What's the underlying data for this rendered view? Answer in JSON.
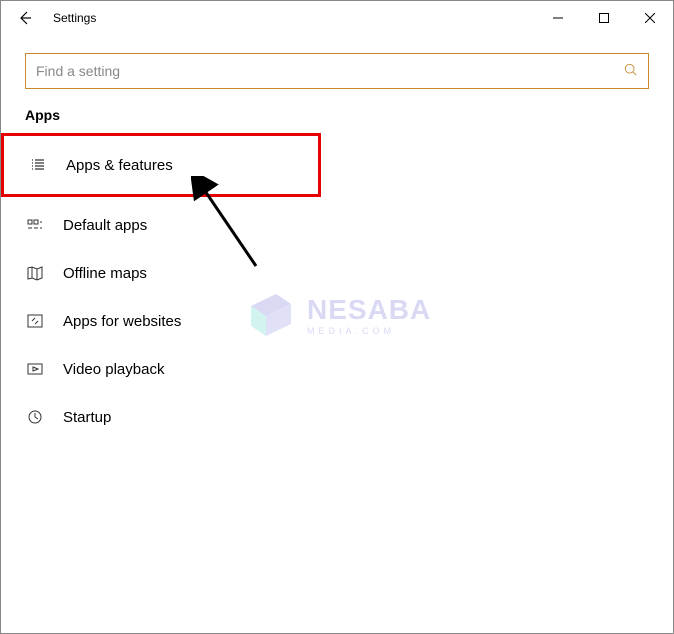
{
  "window": {
    "title": "Settings"
  },
  "search": {
    "placeholder": "Find a setting"
  },
  "section": {
    "title": "Apps"
  },
  "items": [
    {
      "label": "Apps & features",
      "icon": "list-icon",
      "highlighted": true
    },
    {
      "label": "Default apps",
      "icon": "defaults-icon",
      "highlighted": false
    },
    {
      "label": "Offline maps",
      "icon": "map-icon",
      "highlighted": false
    },
    {
      "label": "Apps for websites",
      "icon": "web-icon",
      "highlighted": false
    },
    {
      "label": "Video playback",
      "icon": "video-icon",
      "highlighted": false
    },
    {
      "label": "Startup",
      "icon": "startup-icon",
      "highlighted": false
    }
  ],
  "watermark": {
    "brand": "NESABA",
    "sub": "MEDIA.COM"
  }
}
